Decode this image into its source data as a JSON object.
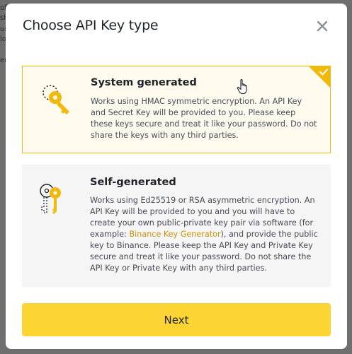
{
  "backdrop": {
    "peek_lines": [
      "of",
      "sh",
      "us",
      "lo",
      "er"
    ]
  },
  "modal": {
    "title": "Choose API Key type",
    "close_icon": "close-icon",
    "options": [
      {
        "title": "System generated",
        "description": "Works using HMAC symmetric encryption. An API Key and Secret Key will be provided to you. Please keep these keys secure and treat it like your password. Do not share the keys with any third parties.",
        "selected": true,
        "icon": "key-dotted-circle-icon"
      },
      {
        "title": "Self-generated",
        "description_before": "Works using Ed25519 or RSA asymmetric encryption. An API Key will be provided to you and you will have to create your own public-private key pair via software (for example: ",
        "link_text": "Binance Key Generator",
        "description_after": "), and provide the public key to Binance. Please keep the API Key and Private Key secure and treat it like your password. Do not share the API Key or Private Key with any third parties.",
        "selected": false,
        "icon": "keys-pair-icon"
      }
    ],
    "next_label": "Next"
  },
  "colors": {
    "accent": "#fcd535",
    "selected_border": "#f0b90b",
    "link": "#c99400",
    "text_primary": "#1e2329",
    "text_secondary": "#474d57"
  }
}
